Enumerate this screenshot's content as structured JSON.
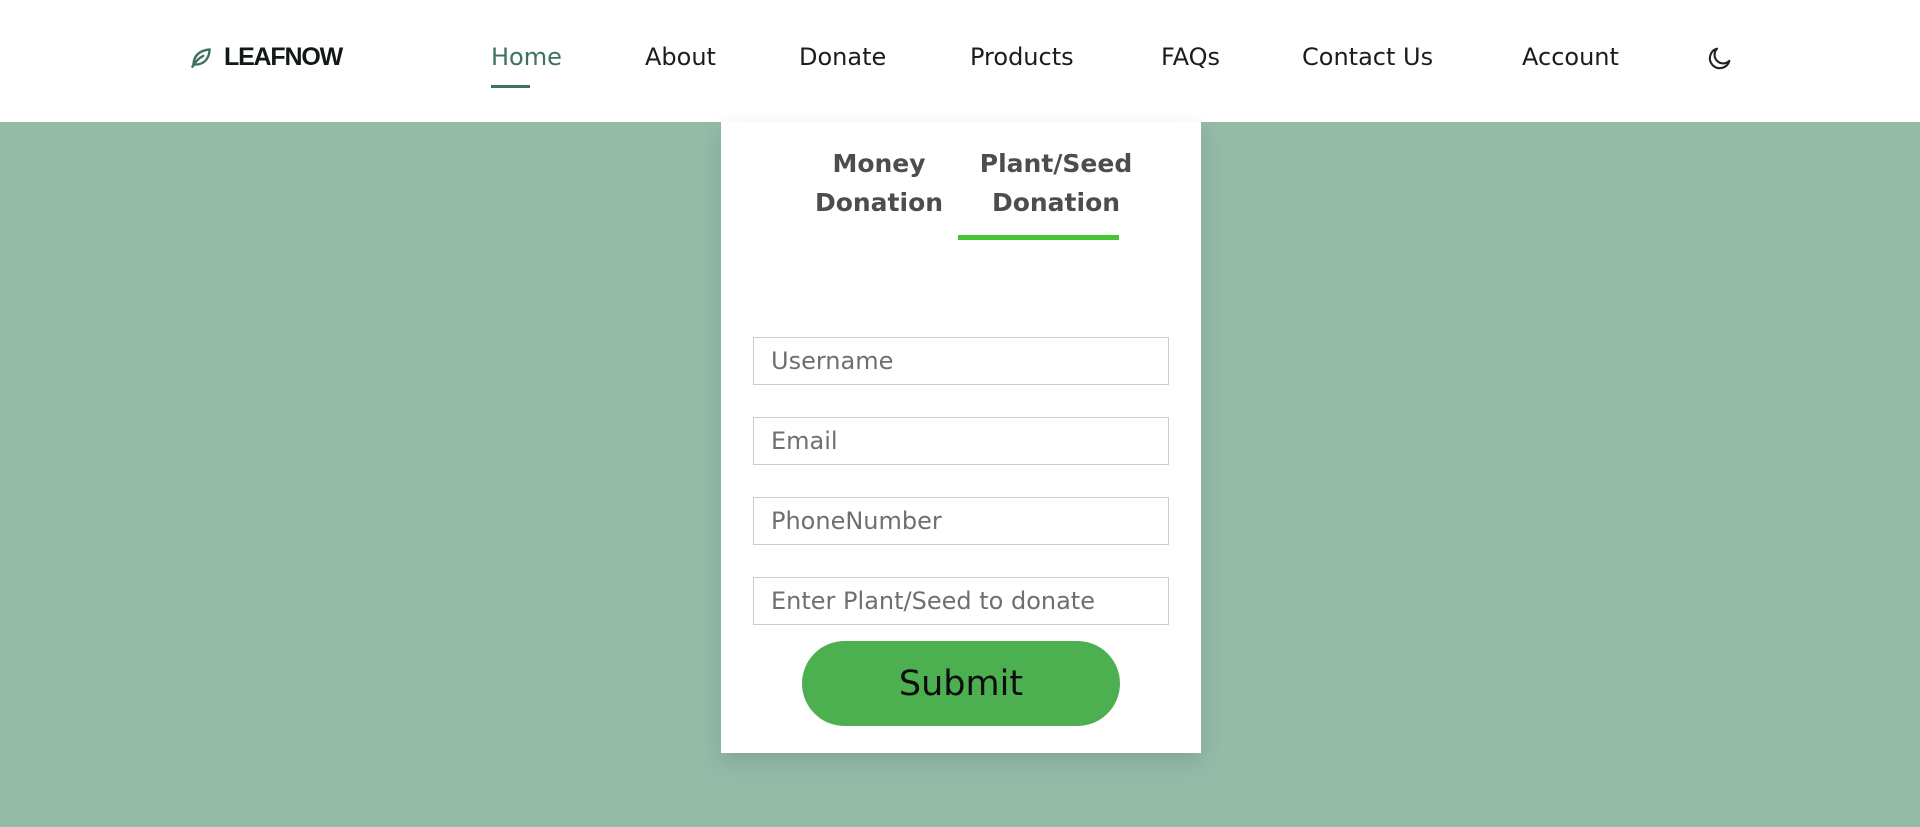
{
  "brand": {
    "name": "LEAFNOW",
    "icon": "leaf-icon",
    "color": "#3f7063"
  },
  "nav": {
    "items": [
      {
        "label": "Home",
        "active": true
      },
      {
        "label": "About"
      },
      {
        "label": "Donate"
      },
      {
        "label": "Products"
      },
      {
        "label": "FAQs"
      },
      {
        "label": "Contact Us"
      },
      {
        "label": "Account"
      }
    ],
    "theme_toggle_icon": "moon-icon"
  },
  "donation": {
    "tabs": [
      {
        "label": "Money\nDonation"
      },
      {
        "label": "Plant/Seed\nDonation",
        "active": true
      }
    ],
    "fields": {
      "username": {
        "placeholder": "Username",
        "value": ""
      },
      "email": {
        "placeholder": "Email",
        "value": ""
      },
      "phone": {
        "placeholder": "PhoneNumber",
        "value": ""
      },
      "plant": {
        "placeholder": "Enter Plant/Seed to donate",
        "value": ""
      }
    },
    "submit_label": "Submit"
  },
  "colors": {
    "page_background": "#93bba8",
    "active_tab_underline": "#46c532",
    "submit_button": "#4caf50"
  }
}
